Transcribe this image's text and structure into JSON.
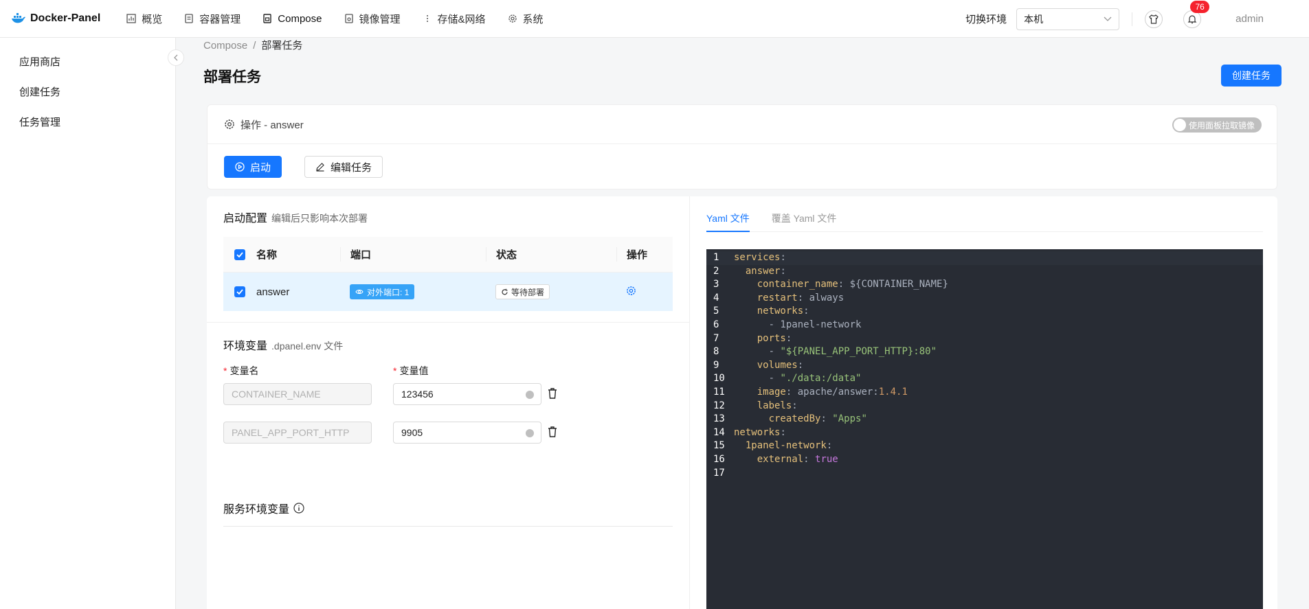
{
  "brand": {
    "name": "Docker-Panel"
  },
  "nav": {
    "items": [
      {
        "label": "概览",
        "icon": "chart-icon"
      },
      {
        "label": "容器管理",
        "icon": "container-icon"
      },
      {
        "label": "Compose",
        "icon": "compose-icon"
      },
      {
        "label": "镜像管理",
        "icon": "image-icon"
      },
      {
        "label": "存储&网络",
        "icon": "storage-icon"
      },
      {
        "label": "系统",
        "icon": "gear-icon"
      }
    ],
    "env_label": "切换环境",
    "env_value": "本机",
    "notification_count": "76",
    "user": "admin"
  },
  "sidebar": {
    "items": [
      {
        "label": "应用商店"
      },
      {
        "label": "创建任务"
      },
      {
        "label": "任务管理"
      }
    ]
  },
  "breadcrumb": {
    "root": "Compose",
    "sep": "/",
    "current": "部署任务"
  },
  "page": {
    "title": "部署任务",
    "create_button": "创建任务"
  },
  "task_card": {
    "header": "操作 - answer",
    "toggle_label": "使用面板拉取镜像",
    "start_button": "启动",
    "edit_button": "编辑任务"
  },
  "startup_config": {
    "title": "启动配置",
    "subtitle": "编辑后只影响本次部署",
    "columns": [
      "名称",
      "端口",
      "状态",
      "操作"
    ],
    "rows": [
      {
        "name": "answer",
        "port": "对外端口: 1",
        "status": "等待部署"
      }
    ]
  },
  "env_vars": {
    "title": "环境变量",
    "subtitle": ".dpanel.env 文件",
    "name_label": "变量名",
    "value_label": "变量值",
    "items": [
      {
        "name_placeholder": "CONTAINER_NAME",
        "value": "123456"
      },
      {
        "name_placeholder": "PANEL_APP_PORT_HTTP",
        "value": "9905"
      }
    ]
  },
  "service_env": {
    "title": "服务环境变量"
  },
  "yaml": {
    "tabs": [
      "Yaml 文件",
      "覆盖 Yaml 文件"
    ],
    "line_numbers": [
      "1",
      "2",
      "3",
      "4",
      "5",
      "6",
      "7",
      "8",
      "9",
      "10",
      "11",
      "12",
      "13",
      "14",
      "15",
      "16",
      "17"
    ],
    "lines": [
      [
        {
          "t": "k",
          "v": "services"
        },
        {
          "t": "p",
          "v": ":"
        }
      ],
      [
        {
          "t": "p",
          "v": "  "
        },
        {
          "t": "k",
          "v": "answer"
        },
        {
          "t": "p",
          "v": ":"
        }
      ],
      [
        {
          "t": "p",
          "v": "    "
        },
        {
          "t": "k",
          "v": "container_name"
        },
        {
          "t": "p",
          "v": ": ${CONTAINER_NAME}"
        }
      ],
      [
        {
          "t": "p",
          "v": "    "
        },
        {
          "t": "k",
          "v": "restart"
        },
        {
          "t": "p",
          "v": ": always"
        }
      ],
      [
        {
          "t": "p",
          "v": "    "
        },
        {
          "t": "k",
          "v": "networks"
        },
        {
          "t": "p",
          "v": ":"
        }
      ],
      [
        {
          "t": "p",
          "v": "      - 1panel-network"
        }
      ],
      [
        {
          "t": "p",
          "v": "    "
        },
        {
          "t": "k",
          "v": "ports"
        },
        {
          "t": "p",
          "v": ":"
        }
      ],
      [
        {
          "t": "p",
          "v": "      - "
        },
        {
          "t": "s",
          "v": "\"${PANEL_APP_PORT_HTTP}:80\""
        }
      ],
      [
        {
          "t": "p",
          "v": "    "
        },
        {
          "t": "k",
          "v": "volumes"
        },
        {
          "t": "p",
          "v": ":"
        }
      ],
      [
        {
          "t": "p",
          "v": "      - "
        },
        {
          "t": "s",
          "v": "\"./data:/data\""
        }
      ],
      [
        {
          "t": "p",
          "v": "    "
        },
        {
          "t": "k",
          "v": "image"
        },
        {
          "t": "p",
          "v": ": apache/answer:"
        },
        {
          "t": "n",
          "v": "1.4.1"
        }
      ],
      [
        {
          "t": "p",
          "v": "    "
        },
        {
          "t": "k",
          "v": "labels"
        },
        {
          "t": "p",
          "v": ":"
        }
      ],
      [
        {
          "t": "p",
          "v": "      "
        },
        {
          "t": "k",
          "v": "createdBy"
        },
        {
          "t": "p",
          "v": ": "
        },
        {
          "t": "s",
          "v": "\"Apps\""
        }
      ],
      [
        {
          "t": "k",
          "v": "networks"
        },
        {
          "t": "p",
          "v": ":"
        }
      ],
      [
        {
          "t": "p",
          "v": "  "
        },
        {
          "t": "k",
          "v": "1panel-network"
        },
        {
          "t": "p",
          "v": ":"
        }
      ],
      [
        {
          "t": "p",
          "v": "    "
        },
        {
          "t": "k",
          "v": "external"
        },
        {
          "t": "p",
          "v": ": "
        },
        {
          "t": "b",
          "v": "true"
        }
      ],
      [
        {
          "t": "p",
          "v": ""
        }
      ]
    ]
  },
  "colors": {
    "primary": "#1677ff",
    "editor_bg": "#282c34",
    "badge": "#f5222d"
  }
}
